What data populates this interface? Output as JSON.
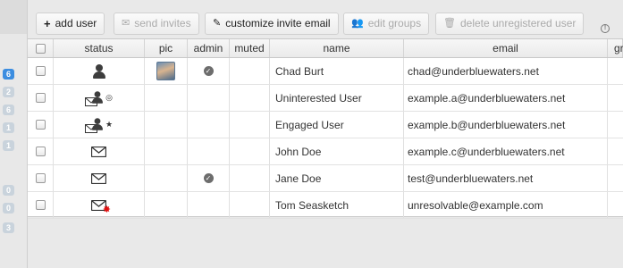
{
  "rail": {
    "badges": [
      {
        "value": "6",
        "active": true
      },
      {
        "value": "2",
        "active": false
      },
      {
        "value": "6",
        "active": false
      },
      {
        "value": "1",
        "active": false
      },
      {
        "value": "1",
        "active": false
      },
      {
        "value": "0",
        "active": false
      },
      {
        "value": "0",
        "active": false
      },
      {
        "value": "3",
        "active": false
      }
    ]
  },
  "toolbar": {
    "add_user": "add user",
    "send_invites": "send invites",
    "customize_invite_email": "customize invite email",
    "edit_groups": "edit groups",
    "delete_unregistered_user": "delete unregistered user"
  },
  "table": {
    "columns": [
      "status",
      "pic",
      "admin",
      "muted",
      "name",
      "email",
      "groups"
    ],
    "rows": [
      {
        "status": "user-registered",
        "pic": true,
        "admin": true,
        "name": "Chad Burt",
        "email": "chad@underbluewaters.net"
      },
      {
        "status": "invited-uninterested",
        "pic": false,
        "admin": false,
        "name": "Uninterested User",
        "email": "example.a@underbluewaters.net"
      },
      {
        "status": "invited-engaged",
        "pic": false,
        "admin": false,
        "name": "Engaged User",
        "email": "example.b@underbluewaters.net"
      },
      {
        "status": "invite-pending",
        "pic": false,
        "admin": false,
        "name": "John Doe",
        "email": "example.c@underbluewaters.net"
      },
      {
        "status": "invite-pending",
        "pic": false,
        "admin": true,
        "name": "Jane Doe",
        "email": "test@underbluewaters.net"
      },
      {
        "status": "invite-failed",
        "pic": false,
        "admin": false,
        "name": "Tom Seasketch",
        "email": "unresolvable@example.com"
      }
    ]
  },
  "colors": {
    "rail_active": "#3b8de0",
    "rail_inactive": "#c9d3dc",
    "error": "#e01010"
  }
}
